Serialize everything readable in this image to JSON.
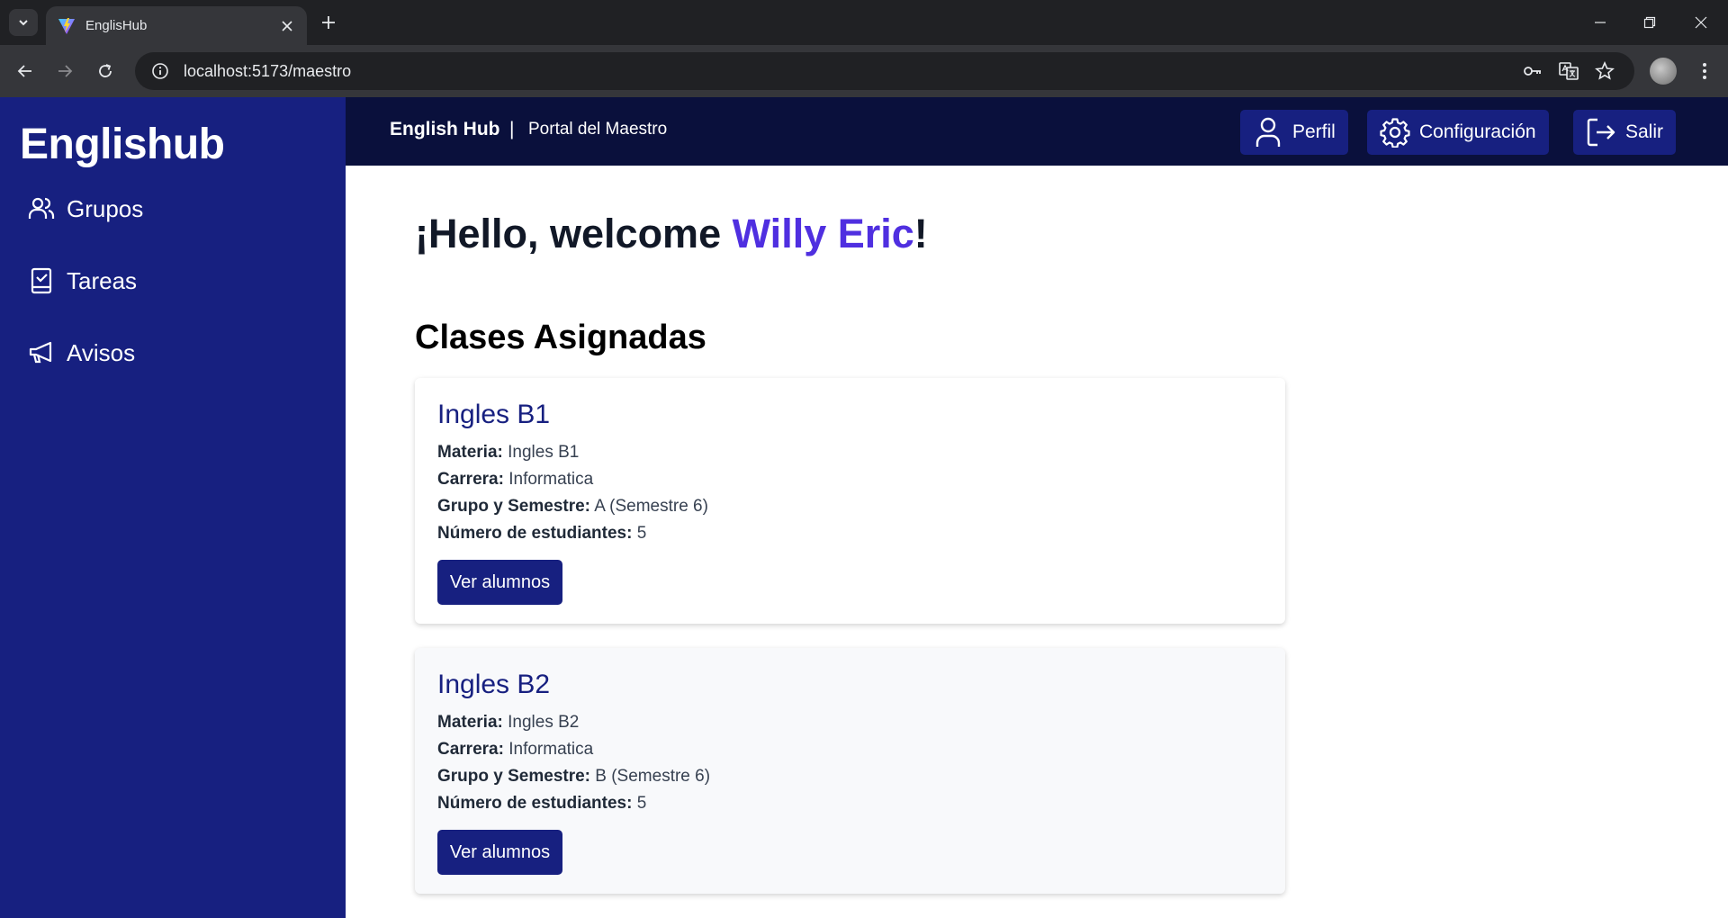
{
  "browser": {
    "tab_title": "EnglisHub",
    "url": "localhost:5173/maestro"
  },
  "sidebar": {
    "brand": "Englishub",
    "items": [
      {
        "label": "Grupos",
        "icon": "users-icon"
      },
      {
        "label": "Tareas",
        "icon": "clipboard-check-icon"
      },
      {
        "label": "Avisos",
        "icon": "megaphone-icon"
      }
    ]
  },
  "topbar": {
    "brand": "English Hub",
    "separator": "|",
    "portal": "Portal del Maestro",
    "buttons": [
      {
        "label": "Perfil",
        "icon": "user-icon"
      },
      {
        "label": "Configuración",
        "icon": "gear-icon"
      },
      {
        "label": "Salir",
        "icon": "logout-icon"
      }
    ]
  },
  "main": {
    "greeting_prefix": "¡Hello, welcome ",
    "user_name": "Willy Eric",
    "greeting_suffix": "!",
    "section_title": "Clases Asignadas",
    "classes": [
      {
        "title": "Ingles B1",
        "materia_label": "Materia:",
        "materia": "Ingles B1",
        "carrera_label": "Carrera:",
        "carrera": "Informatica",
        "grupo_label": "Grupo y Semestre:",
        "grupo": "A (Semestre 6)",
        "estudiantes_label": "Número de estudiantes:",
        "estudiantes": "5",
        "button": "Ver alumnos"
      },
      {
        "title": "Ingles B2",
        "materia_label": "Materia:",
        "materia": "Ingles B2",
        "carrera_label": "Carrera:",
        "carrera": "Informatica",
        "grupo_label": "Grupo y Semestre:",
        "grupo": "B (Semestre 6)",
        "estudiantes_label": "Número de estudiantes:",
        "estudiantes": "5",
        "button": "Ver alumnos"
      }
    ]
  },
  "colors": {
    "sidebar": "#172080",
    "topbar": "#0a103c",
    "accent_name": "#4f2fe0",
    "card_title": "#172080",
    "button": "#172080"
  }
}
